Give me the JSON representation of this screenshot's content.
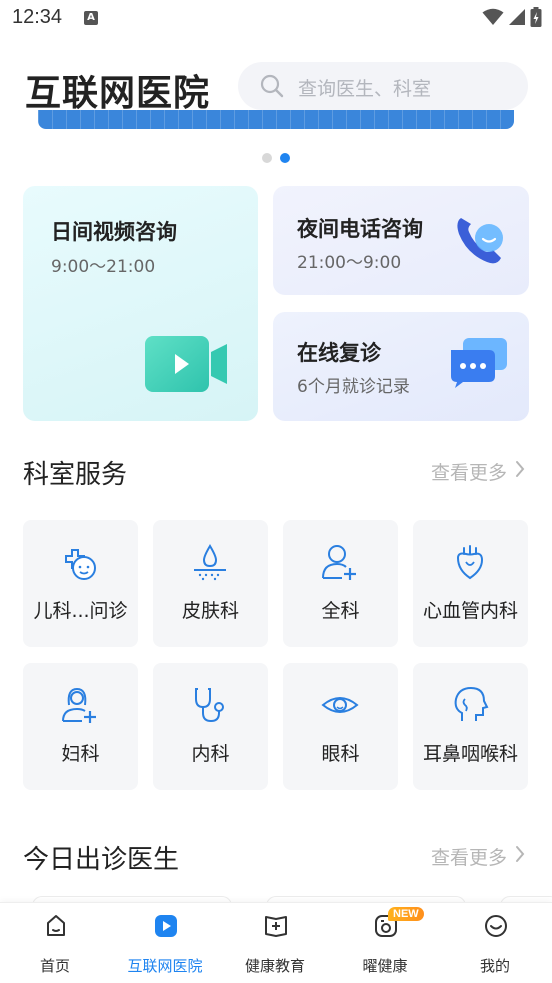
{
  "status_bar": {
    "time": "12:34",
    "a_badge": "A"
  },
  "header": {
    "title": "互联网医院",
    "search_placeholder": "查询医生、科室"
  },
  "carousel": {
    "pages": 2,
    "active_index": 1,
    "banner_color": "#3a86db"
  },
  "service_cards": {
    "video": {
      "title": "日间视频咨询",
      "hours": "9:00～21:00"
    },
    "phone": {
      "title": "夜间电话咨询",
      "hours": "21:00～9:00"
    },
    "followup": {
      "title": "在线复诊",
      "subtitle": "6个月就诊记录"
    }
  },
  "departments": {
    "title": "科室服务",
    "more": "查看更多",
    "items": [
      {
        "label": "儿科...问诊",
        "icon": "baby-icon"
      },
      {
        "label": "皮肤科",
        "icon": "skin-icon"
      },
      {
        "label": "全科",
        "icon": "person-plus-icon"
      },
      {
        "label": "心血管内科",
        "icon": "heart-icon"
      },
      {
        "label": "妇科",
        "icon": "woman-plus-icon"
      },
      {
        "label": "内科",
        "icon": "stethoscope-icon"
      },
      {
        "label": "眼科",
        "icon": "eye-icon"
      },
      {
        "label": "耳鼻咽喉科",
        "icon": "ent-head-icon"
      }
    ]
  },
  "doctors_today": {
    "title": "今日出诊医生",
    "more": "查看更多"
  },
  "tabbar": {
    "active_index": 1,
    "new_badge": "NEW",
    "items": [
      {
        "label": "首页",
        "icon": "home-icon"
      },
      {
        "label": "互联网医院",
        "icon": "hospital-play-icon"
      },
      {
        "label": "健康教育",
        "icon": "book-plus-icon"
      },
      {
        "label": "曜健康",
        "icon": "health-shield-icon"
      },
      {
        "label": "我的",
        "icon": "smile-face-icon"
      }
    ]
  },
  "colors": {
    "accent": "#1f84f0",
    "icon_blue": "#2a7fe0",
    "badge_orange": "#ffa01c",
    "video_teal": "#3fd3b8"
  }
}
